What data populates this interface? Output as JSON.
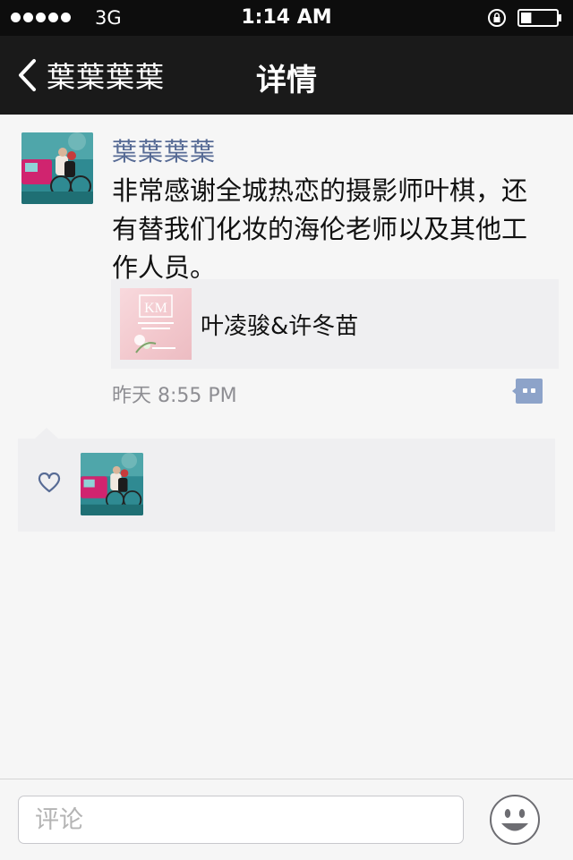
{
  "status_bar": {
    "carrier": "3G",
    "time": "1:14 AM",
    "battery_level": 0.3
  },
  "nav": {
    "back_label": "葉葉葉葉",
    "title": "详情"
  },
  "post": {
    "author": "葉葉葉葉",
    "text": "非常感谢全城热恋的摄影师叶棋，还有替我们化妆的海伦老师以及其他工作人员。",
    "link": {
      "title": "叶凌骏&许冬苗",
      "thumbnail_text": "KM"
    },
    "time": "昨天 8:55 PM"
  },
  "likes": {
    "icon": "heart-icon"
  },
  "comment_bar": {
    "placeholder": "评论"
  },
  "colors": {
    "name_blue": "#576b95",
    "nav_bg": "#1a1a1a",
    "panel_bg": "#efeff1",
    "time_gray": "#8e8e93"
  }
}
